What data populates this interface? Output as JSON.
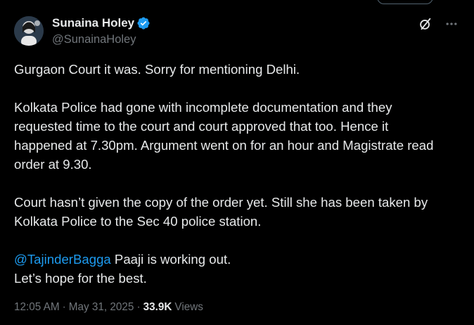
{
  "colors": {
    "background": "#000000",
    "text_primary": "#e7e9ea",
    "text_secondary": "#71767b",
    "accent": "#1d9bf0"
  },
  "author": {
    "display_name": "Sunaina Holey",
    "handle": "@SunainaHoley",
    "verified": true,
    "avatar_icon": "profile-photo"
  },
  "header_actions": {
    "grok_icon": "grok-icon",
    "more_icon": "more-horizontal-icon"
  },
  "tweet": {
    "line1": "Gurgaon Court it was. Sorry for mentioning Delhi.",
    "para2": [
      "Kolkata Police had gone with incomplete documentation and they",
      "requested time to the court and court approved that too. Hence it",
      "happened at 7.30pm. Argument went on for an hour and Magistrate read",
      "order at 9.30."
    ],
    "para3": [
      "Court hasn’t given the copy of the order yet. Still she has been taken by",
      "Kolkata Police to the Sec 40 police station."
    ],
    "mention": "@TajinderBagga",
    "mention_suffix": " Paaji is working out.",
    "closing": "Let’s hope for the best."
  },
  "meta": {
    "time": "12:05 AM",
    "separator1": "·",
    "date": "May 31, 2025",
    "separator2": "·",
    "views_count": "33.9K",
    "views_label": "Views"
  }
}
